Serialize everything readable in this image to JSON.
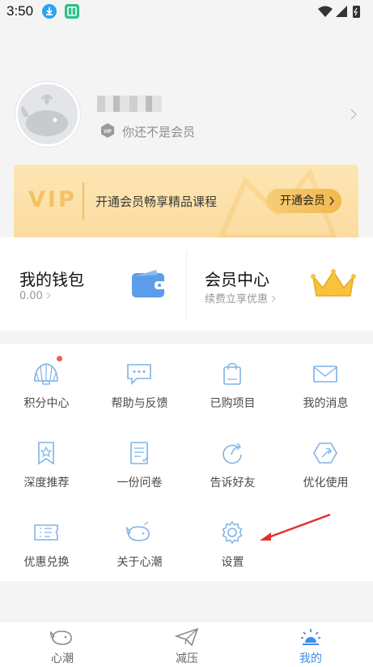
{
  "status_bar": {
    "time": "3:50"
  },
  "profile": {
    "member_status": "你还不是会员"
  },
  "vip_banner": {
    "logo": "VIP",
    "text": "开通会员畅享精品课程",
    "button_label": "开通会员"
  },
  "wallet": {
    "title": "我的钱包",
    "balance": "0.00"
  },
  "member_center": {
    "title": "会员中心",
    "subtitle": "续费立享优惠"
  },
  "grid": {
    "items": [
      {
        "label": "积分中心",
        "icon": "shell-icon"
      },
      {
        "label": "帮助与反馈",
        "icon": "chat-bubble-icon"
      },
      {
        "label": "已购项目",
        "icon": "shopping-bag-icon"
      },
      {
        "label": "我的消息",
        "icon": "mail-icon"
      },
      {
        "label": "深度推荐",
        "icon": "bookmark-star-icon"
      },
      {
        "label": "一份问卷",
        "icon": "questionnaire-icon"
      },
      {
        "label": "告诉好友",
        "icon": "share-icon"
      },
      {
        "label": "优化使用",
        "icon": "wrench-icon"
      },
      {
        "label": "优惠兑换",
        "icon": "coupon-icon"
      },
      {
        "label": "关于心潮",
        "icon": "whale-icon"
      },
      {
        "label": "设置",
        "icon": "gear-icon"
      }
    ]
  },
  "bottom_nav": {
    "items": [
      {
        "label": "心潮",
        "icon": "whale-icon"
      },
      {
        "label": "减压",
        "icon": "paper-plane-icon"
      },
      {
        "label": "我的",
        "icon": "profile-sun-icon",
        "active": true
      }
    ]
  },
  "colors": {
    "accent": "#3d8fe8",
    "icon_blue": "#7fb3e6",
    "vip_gold": "#f4c162",
    "annotation": "#e53030"
  }
}
